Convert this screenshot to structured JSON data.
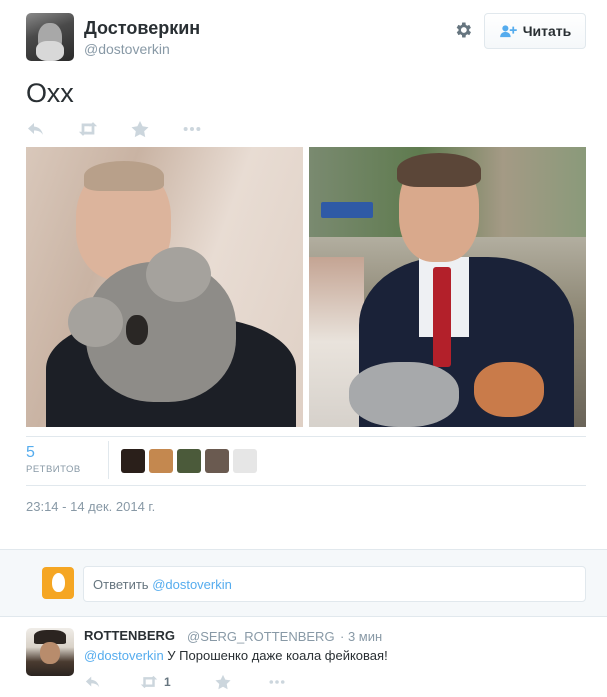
{
  "tweet": {
    "display_name": "Достоверкин",
    "screen_name": "@dostoverkin",
    "text": "Охх",
    "retweet_count": "5",
    "retweet_label": "РЕТВИТОВ",
    "timestamp": "23:14 - 14 дек. 2014 г."
  },
  "header": {
    "follow_label": "Читать",
    "settings_icon": "gear-icon"
  },
  "actions": [
    {
      "name": "reply-icon"
    },
    {
      "name": "retweet-icon"
    },
    {
      "name": "favorite-icon"
    },
    {
      "name": "more-icon"
    }
  ],
  "retweeter_avatars": [
    {
      "color": "#2a1f1a"
    },
    {
      "color": "#c4884f"
    },
    {
      "color": "#4b5a3a"
    },
    {
      "color": "#6a5a50"
    },
    {
      "color": "#e6e6e6"
    }
  ],
  "reply_box": {
    "prefix": "Ответить ",
    "mention": "@dostoverkin"
  },
  "reply_tweet": {
    "name": "ROTTENBERG",
    "handle": "@SERG_ROTTENBERG",
    "time": "· 3 мин",
    "mention": "@dostoverkin",
    "text": " У Порошенко даже коала фейковая!",
    "retweet_count": "1"
  },
  "colors": {
    "accent": "#55acee",
    "text": "#292f33",
    "muted": "#8899a6",
    "action": "#ccd6dd"
  }
}
